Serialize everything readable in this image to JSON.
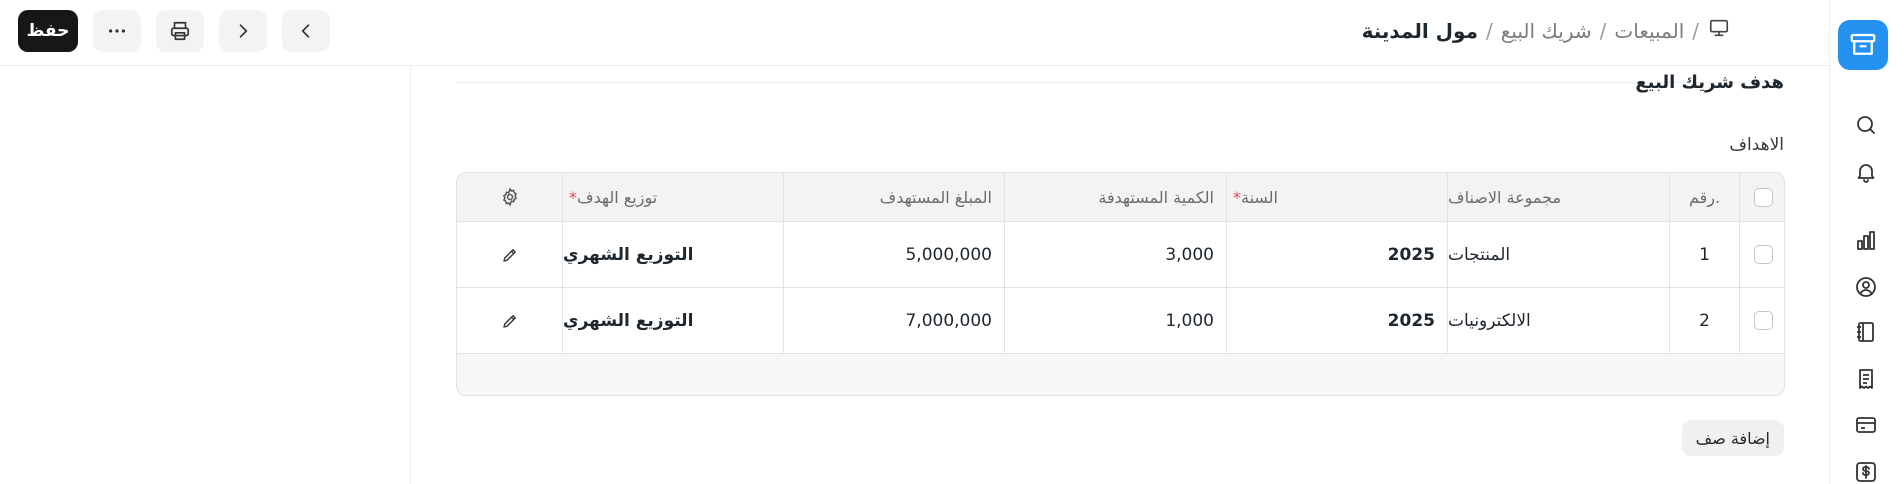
{
  "toolbar": {
    "save_label": "حفظ",
    "more_icon": "more-horizontal-icon",
    "print_icon": "printer-icon",
    "next_icon": "chevron-right-icon",
    "prev_icon": "chevron-left-icon"
  },
  "breadcrumb": {
    "icon": "monitor-icon",
    "items": [
      "المبيعات",
      "شريك البيع"
    ],
    "separator": "/",
    "current": "مول المدينة"
  },
  "sidebar": {
    "logo_icon": "app-logo-icon",
    "brand_color": "#2490ef",
    "icons": [
      "search-icon",
      "bell-icon",
      "bar-chart-icon",
      "user-circle-icon",
      "notebook-icon",
      "receipt-icon",
      "credit-card-icon",
      "dollar-icon"
    ]
  },
  "section": {
    "title": "هدف شريك البيع",
    "targets_label": "الاهداف"
  },
  "table": {
    "headers": {
      "no": "رقم.",
      "item_group": "مجموعة الاصناف",
      "fiscal_year": "السنة",
      "target_qty": "الكمية المستهدفة",
      "target_amount": "المبلغ المستهدف",
      "distribution": "توزيع الهدف",
      "required_mark": "*"
    },
    "rows": [
      {
        "no": "1",
        "item_group": "المنتجات",
        "fiscal_year": "2025",
        "target_qty": "3,000",
        "target_amount": "5,000,000",
        "distribution": "التوزيع الشهري"
      },
      {
        "no": "2",
        "item_group": "الالكترونيات",
        "fiscal_year": "2025",
        "target_qty": "1,000",
        "target_amount": "7,000,000",
        "distribution": "التوزيع الشهري"
      }
    ],
    "add_row_label": "إضافة صف"
  }
}
